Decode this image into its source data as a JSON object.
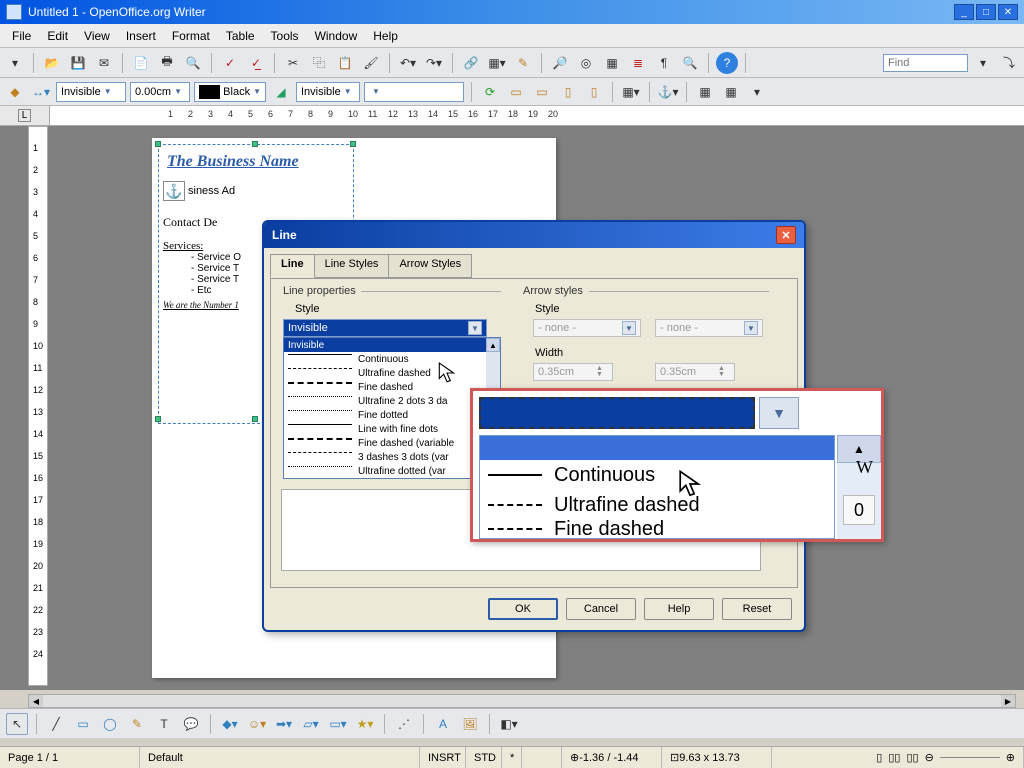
{
  "window": {
    "title": "Untitled 1 - OpenOffice.org Writer"
  },
  "menu": {
    "items": [
      "File",
      "Edit",
      "View",
      "Insert",
      "Format",
      "Table",
      "Tools",
      "Window",
      "Help"
    ]
  },
  "toolbar1": {
    "find_placeholder": "Find"
  },
  "toolbar2": {
    "line_style": "Invisible",
    "line_width": "0.00cm",
    "line_color": "Black",
    "arrow_style": "Invisible"
  },
  "ruler": {
    "marks": [
      1,
      2,
      3,
      4,
      5,
      6,
      7,
      8,
      9,
      10,
      11,
      12,
      13,
      14,
      15,
      16,
      17,
      18,
      19,
      20
    ]
  },
  "vruler": {
    "marks": [
      1,
      2,
      3,
      4,
      5,
      6,
      7,
      8,
      9,
      10,
      11,
      12,
      13,
      14,
      15,
      16,
      17,
      18,
      19,
      20,
      21,
      22,
      23,
      24
    ]
  },
  "doc": {
    "biz": "The Business Name",
    "addr": "siness Ad",
    "contact": "Contact De",
    "services_hdr": "Services:",
    "services": [
      "Service O",
      "Service T",
      "Service T",
      "Etc"
    ],
    "tagline": "We are the Number 1"
  },
  "dialog": {
    "title": "Line",
    "tabs": {
      "t1": "Line",
      "t2": "Line Styles",
      "t3": "Arrow Styles"
    },
    "sections": {
      "props": "Line properties",
      "arrows": "Arrow styles"
    },
    "labels": {
      "style": "Style",
      "width": "Width"
    },
    "style_combo": "Invisible",
    "arrow_style_left": "- none -",
    "arrow_style_right": "- none -",
    "arrow_width_left": "0.35cm",
    "arrow_width_right": "0.35cm",
    "dd": {
      "sel": "Invisible",
      "opts": [
        "Continuous",
        "Ultrafine dashed",
        "Fine dashed",
        "Ultrafine 2 dots 3 da",
        "Fine dotted",
        "Line with fine dots",
        "Fine dashed (variable",
        "3 dashes 3 dots (var",
        "Ultrafine dotted (var"
      ]
    },
    "buttons": {
      "ok": "OK",
      "cancel": "Cancel",
      "help": "Help",
      "reset": "Reset"
    }
  },
  "callout": {
    "opts": {
      "o1": "Continuous",
      "o2": "Ultrafine dashed",
      "o3": "Fine dashed"
    },
    "W": "W",
    "zero": "0"
  },
  "status": {
    "page": "Page 1 / 1",
    "style": "Default",
    "insrt": "INSRT",
    "std": "STD",
    "star": "*",
    "coords": "-1.36 / -1.44",
    "size": "9.63 x 13.73"
  }
}
